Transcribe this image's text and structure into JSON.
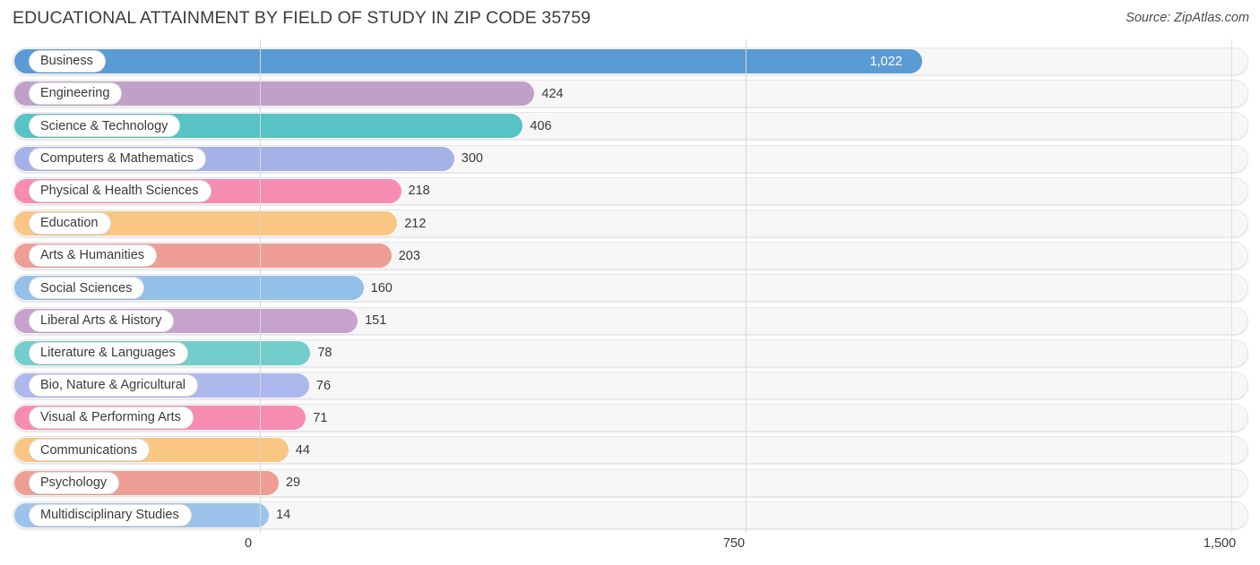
{
  "header": {
    "title": "EDUCATIONAL ATTAINMENT BY FIELD OF STUDY IN ZIP CODE 35759",
    "source": "Source: ZipAtlas.com"
  },
  "chart_data": {
    "type": "bar",
    "orientation": "horizontal",
    "title": "EDUCATIONAL ATTAINMENT BY FIELD OF STUDY IN ZIP CODE 35759",
    "subtitle": "",
    "xlabel": "",
    "ylabel": "",
    "xlim": [
      0,
      1500
    ],
    "xticks": [
      "0",
      "750",
      "1,500"
    ],
    "xtick_values": [
      0,
      750,
      1500
    ],
    "grid": true,
    "legend": false,
    "categories": [
      "Business",
      "Engineering",
      "Science & Technology",
      "Computers & Mathematics",
      "Physical & Health Sciences",
      "Education",
      "Arts & Humanities",
      "Social Sciences",
      "Liberal Arts & History",
      "Literature & Languages",
      "Bio, Nature & Agricultural",
      "Visual & Performing Arts",
      "Communications",
      "Psychology",
      "Multidisciplinary Studies"
    ],
    "values": [
      1022,
      424,
      406,
      300,
      218,
      212,
      203,
      160,
      151,
      78,
      76,
      71,
      44,
      29,
      14
    ],
    "value_labels": [
      "1,022",
      "424",
      "406",
      "300",
      "218",
      "212",
      "203",
      "160",
      "151",
      "78",
      "76",
      "71",
      "44",
      "29",
      "14"
    ],
    "colors": [
      "#5b9bd5",
      "#bfa0c9",
      "#57c3c4",
      "#a5b2e8",
      "#f78cb3",
      "#f9c684",
      "#ee9e95",
      "#92c0e9",
      "#c6a3cd",
      "#73cdcb",
      "#adb8ec",
      "#f78cb3",
      "#f9c684",
      "#ee9e95",
      "#9cc3ea"
    ]
  }
}
